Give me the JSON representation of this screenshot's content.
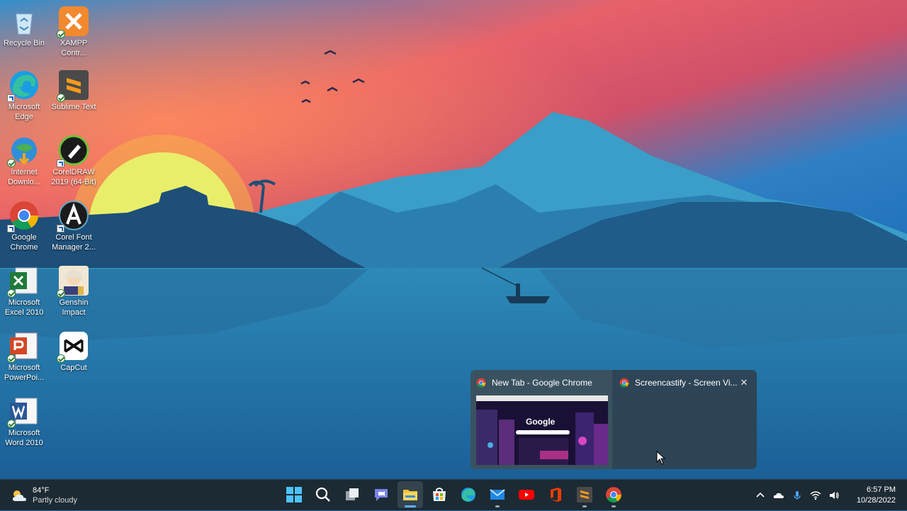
{
  "desktop": {
    "icons": [
      {
        "label": "Recycle Bin",
        "icon": "recycle-bin-icon"
      },
      {
        "label": "XAMPP Contr...",
        "icon": "xampp-icon"
      },
      {
        "label": "Microsoft Edge",
        "icon": "edge-icon"
      },
      {
        "label": "Sublime Text",
        "icon": "sublime-text-icon"
      },
      {
        "label": "Internet Downlo...",
        "icon": "internet-download-manager-icon"
      },
      {
        "label": "CorelDRAW 2019 (64-Bit)",
        "icon": "coreldraw-icon"
      },
      {
        "label": "Google Chrome",
        "icon": "chrome-icon"
      },
      {
        "label": "Corel Font Manager 2...",
        "icon": "corel-font-manager-icon"
      },
      {
        "label": "Microsoft Excel 2010",
        "icon": "excel-icon"
      },
      {
        "label": "Genshin Impact",
        "icon": "genshin-impact-icon"
      },
      {
        "label": "Microsoft PowerPoi...",
        "icon": "powerpoint-icon"
      },
      {
        "label": "CapCut",
        "icon": "capcut-icon"
      },
      {
        "label": "Microsoft Word 2010",
        "icon": "word-icon"
      }
    ]
  },
  "thumbnail_popup": {
    "windows": [
      {
        "title": "New Tab - Google Chrome",
        "preview_text": "Google"
      },
      {
        "title": "Screencastify - Screen Vi...",
        "close_glyph": "✕"
      }
    ]
  },
  "taskbar": {
    "weather": {
      "temp": "84°F",
      "condition": "Partly cloudy"
    },
    "apps": [
      {
        "icon": "start-icon",
        "active": false
      },
      {
        "icon": "search-icon",
        "active": false
      },
      {
        "icon": "task-view-icon",
        "active": false
      },
      {
        "icon": "teams-chat-icon",
        "active": false
      },
      {
        "icon": "file-explorer-icon",
        "active": true
      },
      {
        "icon": "microsoft-store-icon",
        "active": false
      },
      {
        "icon": "edge-icon",
        "active": false
      },
      {
        "icon": "mail-icon",
        "active": false
      },
      {
        "icon": "youtube-icon",
        "active": false
      },
      {
        "icon": "office-icon",
        "active": false
      },
      {
        "icon": "sublime-text-icon",
        "active": false
      },
      {
        "icon": "chrome-icon",
        "active": false
      }
    ],
    "tray": {
      "icons": [
        "chevron-up-icon",
        "onedrive-icon",
        "microphone-icon",
        "wifi-icon",
        "volume-icon"
      ],
      "time": "6:57 PM",
      "date": "10/28/2022"
    }
  },
  "colors": {
    "accent": "#5cb0ff",
    "taskbar": "#1c2a33"
  }
}
